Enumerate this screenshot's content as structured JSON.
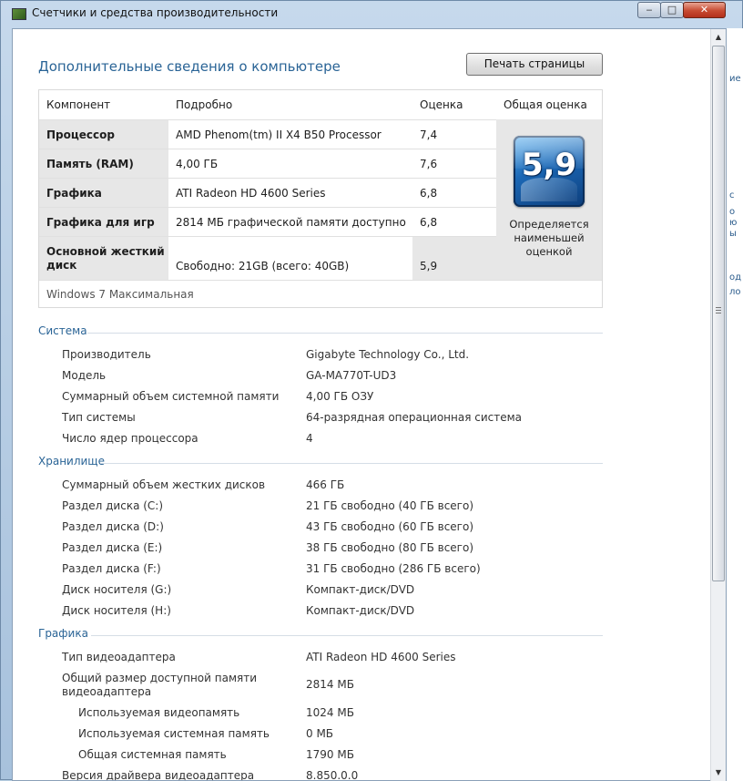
{
  "window": {
    "title": "Счетчики и средства производительности",
    "min_glyph": "‒",
    "max_glyph": "□",
    "close_glyph": "✕"
  },
  "page": {
    "heading": "Дополнительные сведения о компьютере",
    "print_button": "Печать страницы"
  },
  "scores": {
    "headers": {
      "component": "Компонент",
      "detail": "Подробно",
      "score": "Оценка",
      "overall": "Общая оценка"
    },
    "rows": [
      {
        "component": "Процессор",
        "detail": "AMD Phenom(tm) II X4 B50 Processor",
        "score": "7,4"
      },
      {
        "component": "Память (RAM)",
        "detail": "4,00 ГБ",
        "score": "7,6"
      },
      {
        "component": "Графика",
        "detail": "ATI Radeon HD 4600 Series",
        "score": "6,8"
      },
      {
        "component": "Графика для игр",
        "detail": "2814 МБ графической памяти доступно",
        "score": "6,8"
      },
      {
        "component": "Основной жесткий диск",
        "detail": "Свободно: 21GB (всего: 40GB)",
        "score": "5,9"
      }
    ],
    "overall": {
      "score": "5,9",
      "caption": "Определяется наименьшей оценкой"
    },
    "os": "Windows 7 Максимальная"
  },
  "sections": {
    "system": {
      "title": "Система",
      "items": [
        {
          "label": "Производитель",
          "value": "Gigabyte Technology Co., Ltd."
        },
        {
          "label": "Модель",
          "value": "GA-MA770T-UD3"
        },
        {
          "label": "Суммарный объем системной памяти",
          "value": "4,00 ГБ ОЗУ"
        },
        {
          "label": "Тип системы",
          "value": "64-разрядная операционная система"
        },
        {
          "label": "Число ядер процессора",
          "value": "4"
        }
      ]
    },
    "storage": {
      "title": "Хранилище",
      "items": [
        {
          "label": "Суммарный объем жестких дисков",
          "value": "466 ГБ"
        },
        {
          "label": "Раздел диска (C:)",
          "value": "21 ГБ свободно (40 ГБ всего)"
        },
        {
          "label": "Раздел диска (D:)",
          "value": "43 ГБ свободно (60 ГБ всего)"
        },
        {
          "label": "Раздел диска (E:)",
          "value": "38 ГБ свободно (80 ГБ всего)"
        },
        {
          "label": "Раздел диска (F:)",
          "value": "31 ГБ свободно (286 ГБ всего)"
        },
        {
          "label": "Диск носителя (G:)",
          "value": "Компакт-диск/DVD"
        },
        {
          "label": "Диск носителя (H:)",
          "value": "Компакт-диск/DVD"
        }
      ]
    },
    "graphics": {
      "title": "Графика",
      "items": [
        {
          "label": "Тип видеоадаптера",
          "value": "ATI Radeon HD 4600 Series"
        },
        {
          "label": "Общий размер доступной памяти видеоадаптера",
          "value": "2814 МБ"
        },
        {
          "label": "Используемая видеопамять",
          "value": "1024 МБ"
        },
        {
          "label": "Используемая системная память",
          "value": "0 МБ"
        },
        {
          "label": "Общая системная память",
          "value": "1790 МБ"
        },
        {
          "label": "Версия драйвера видеоадаптера",
          "value": "8.850.0.0"
        }
      ]
    }
  },
  "background_window": {
    "fragments": [
      "ие",
      "с",
      "о",
      "ю",
      "ы",
      "од",
      "ло"
    ]
  }
}
